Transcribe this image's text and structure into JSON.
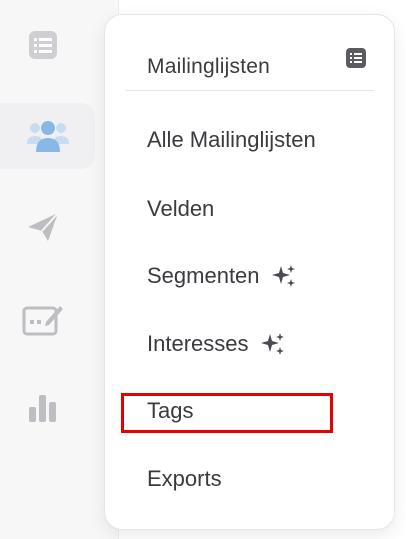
{
  "menu": {
    "title": "Mailinglijsten",
    "items": [
      {
        "label": "Alle Mailinglijsten"
      },
      {
        "label": "Velden"
      },
      {
        "label": "Segmenten",
        "badge_icon": "sparkle-icon"
      },
      {
        "label": "Interesses",
        "badge_icon": "sparkle-icon"
      },
      {
        "label": "Tags"
      },
      {
        "label": "Exports"
      }
    ]
  },
  "sidebar": {
    "icons": [
      "list-icon",
      "users-icon",
      "send-icon",
      "edit-form-icon",
      "bar-chart-icon"
    ],
    "active_icon": "users-icon"
  },
  "colors": {
    "accent_blue": "#8ab8e6",
    "icon_gray": "#bdbdc2",
    "text": "#3a3a3f",
    "highlight": "#e60000"
  }
}
